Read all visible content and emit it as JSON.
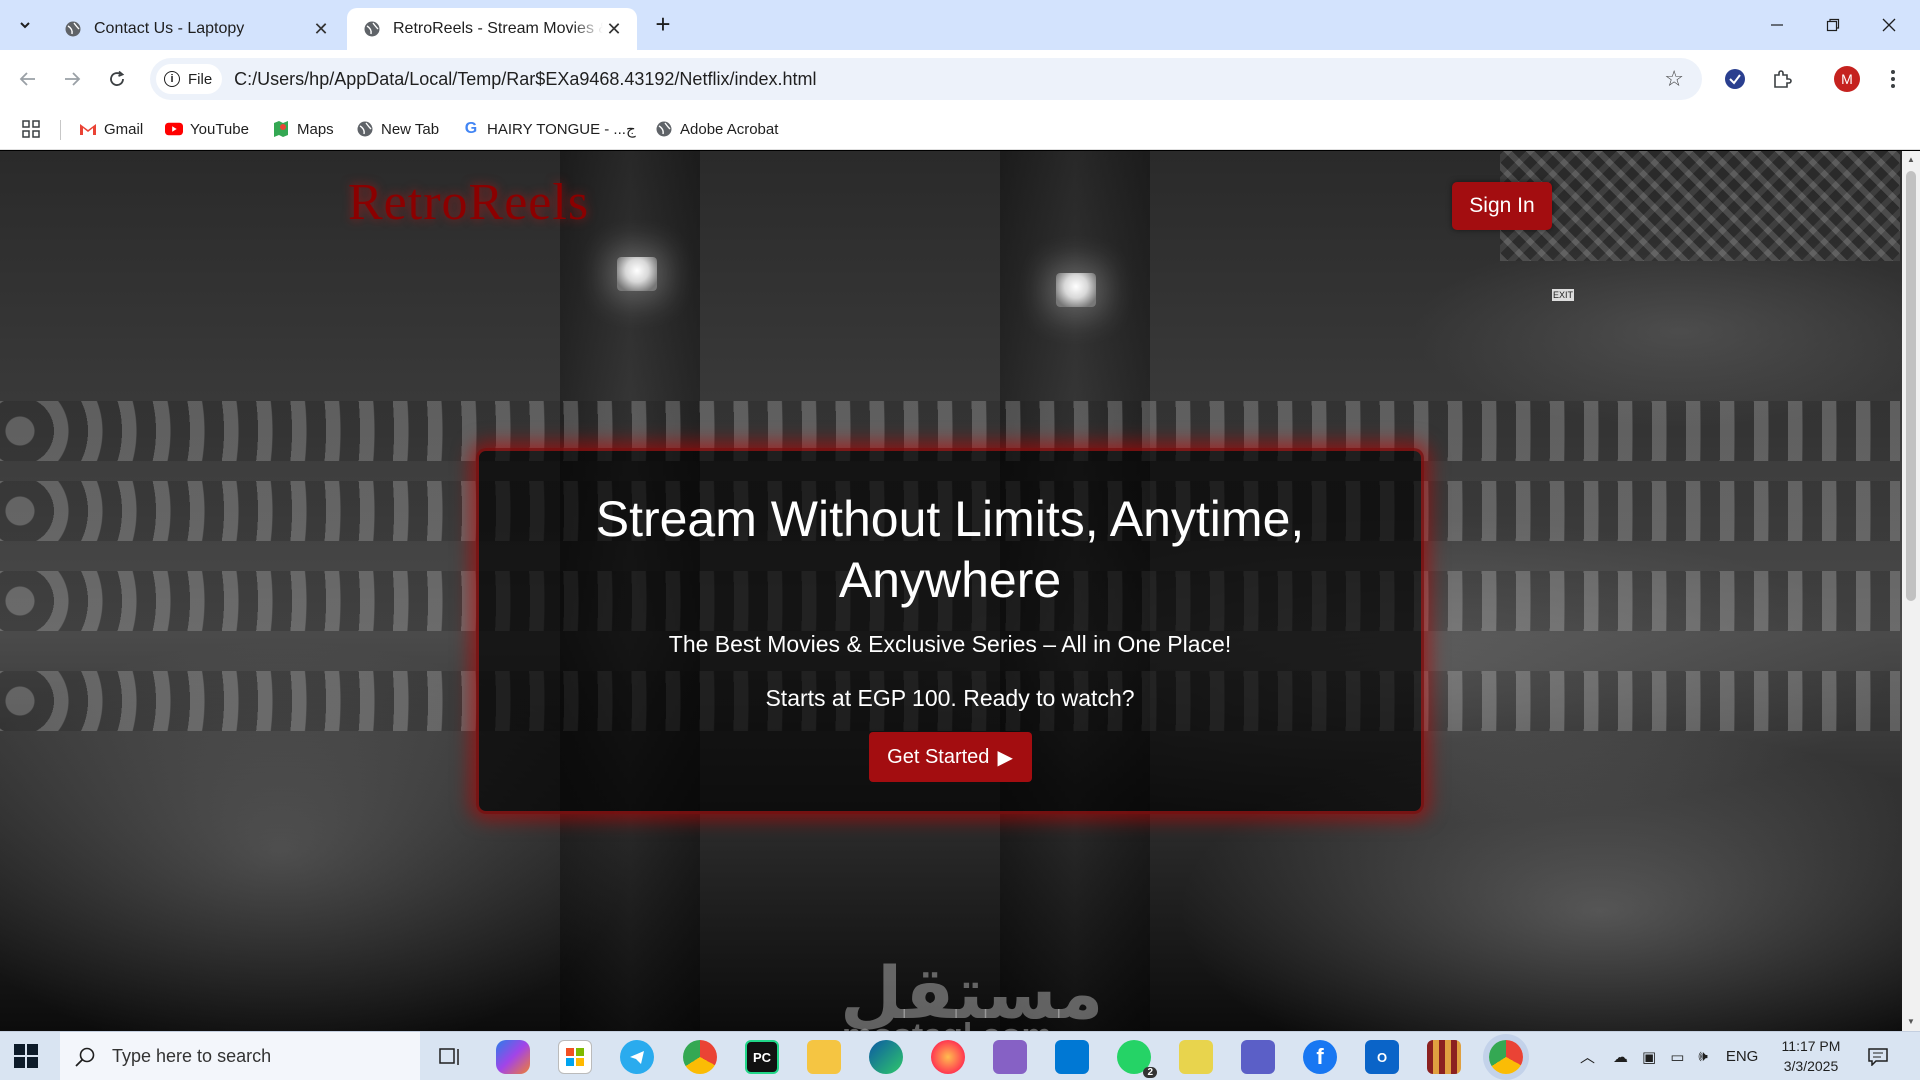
{
  "browser": {
    "tabs": [
      {
        "title": "Contact Us - Laptopy",
        "active": false
      },
      {
        "title": "RetroReels - Stream Movies & Series",
        "active": true
      }
    ],
    "address": {
      "scheme_chip": "File",
      "url": "C:/Users/hp/AppData/Local/Temp/Rar$EXa9468.43192/Netflix/index.html"
    },
    "profile_initial": "M",
    "bookmarks": [
      {
        "label": "Gmail",
        "icon": "gmail-icon"
      },
      {
        "label": "YouTube",
        "icon": "youtube-icon"
      },
      {
        "label": "Maps",
        "icon": "maps-icon"
      },
      {
        "label": "New Tab",
        "icon": "globe-icon"
      },
      {
        "label": "HAIRY TONGUE - ...ج",
        "icon": "google-icon"
      },
      {
        "label": "Adobe Acrobat",
        "icon": "globe-icon"
      }
    ]
  },
  "page": {
    "logo": "RetroReels",
    "sign_in": "Sign In",
    "hero": {
      "title": "Stream Without Limits, Anytime, Anywhere",
      "subtitle": "The Best Movies & Exclusive Series – All in One Place!",
      "price_line": "Starts at EGP 100. Ready to watch?",
      "cta": "Get Started",
      "cta_icon": "▶"
    },
    "watermark": {
      "arabic": "مستقل",
      "latin": "mostaql.com"
    },
    "exit_sign": "EXIT"
  },
  "taskbar": {
    "search_placeholder": "Type here to search",
    "language": "ENG",
    "time": "11:17 PM",
    "date": "3/3/2025",
    "whatsapp_badge": "2"
  },
  "colors": {
    "brand_red": "#a30d10",
    "logo_red": "#8b0000",
    "tabstrip": "#d3e3fd"
  }
}
